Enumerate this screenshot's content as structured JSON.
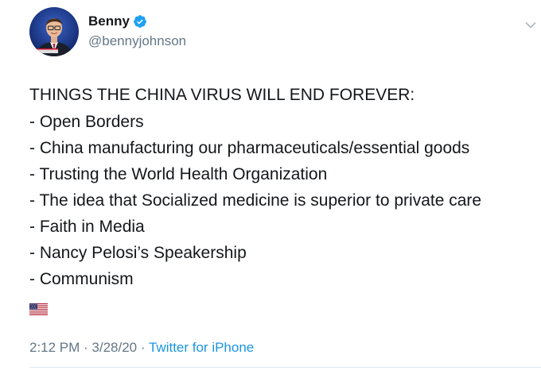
{
  "user": {
    "display_name": "Benny",
    "handle": "@bennyjohnson",
    "verified": true,
    "verified_color": "#1da1f2"
  },
  "tweet": {
    "headline": "THINGS THE CHINA VIRUS WILL END FOREVER:",
    "items": [
      "- Open Borders",
      "- China manufacturing our pharmaceuticals/essential goods",
      "- Trusting the World Health Organization",
      "- The idea that Socialized medicine is superior to private care",
      "- Faith in Media",
      "- Nancy Pelosi’s Speakership",
      "- Communism"
    ],
    "emoji": "us-flag-emoji"
  },
  "meta": {
    "time": "2:12 PM",
    "separator_1": " · ",
    "date": "3/28/20",
    "separator_2": " · ",
    "source": "Twitter for iPhone"
  },
  "icons": {
    "more": "chevron-down-icon",
    "verified": "verified-badge-icon"
  },
  "colors": {
    "text": "#14171a",
    "secondary": "#657786",
    "link": "#1b95e0"
  }
}
